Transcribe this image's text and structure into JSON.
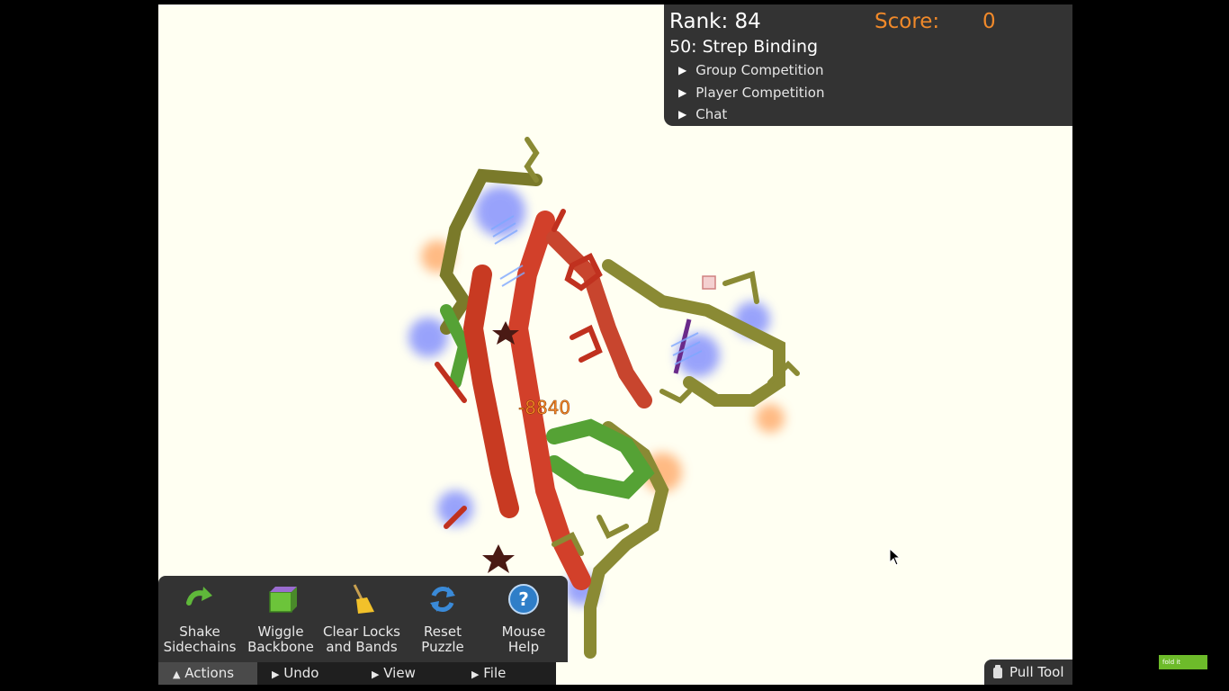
{
  "panel": {
    "rank": "Rank: 84",
    "score_label": "Score:",
    "score_value": "0",
    "puzzle": "50: Strep Binding",
    "links": [
      "Group Competition",
      "Player Competition",
      "Chat"
    ]
  },
  "protein": {
    "energy_label": "-8840"
  },
  "actions": [
    {
      "line1": "Shake",
      "line2": "Sidechains",
      "icon": "shake-arrow-icon"
    },
    {
      "line1": "Wiggle",
      "line2": "Backbone",
      "icon": "wiggle-cube-icon"
    },
    {
      "line1": "Clear Locks",
      "line2": "and Bands",
      "icon": "broom-icon"
    },
    {
      "line1": "Reset",
      "line2": "Puzzle",
      "icon": "reset-arrows-icon"
    },
    {
      "line1": "Mouse",
      "line2": "Help",
      "icon": "question-icon"
    }
  ],
  "menu": {
    "actions": "Actions",
    "undo": "Undo",
    "view": "View",
    "file": "File"
  },
  "pull_tool": "Pull Tool",
  "watermark": "fold it"
}
